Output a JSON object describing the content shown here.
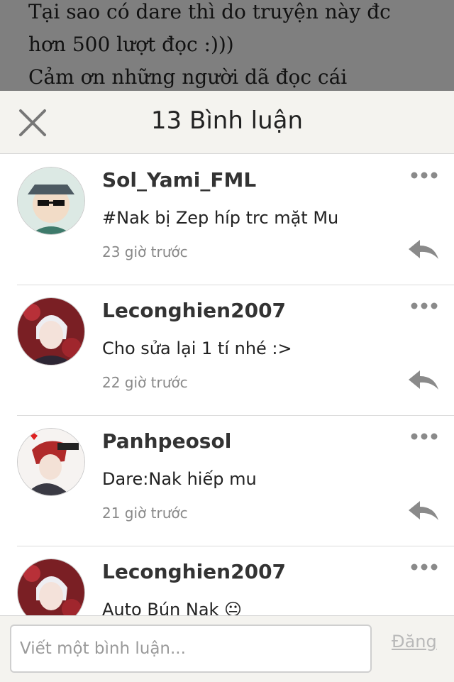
{
  "story": {
    "lines": [
      "Tại sao có dare thì do truyện này đc",
      "hơn 500 lượt đọc :)))",
      "Cảm ơn những người dã đọc cái"
    ]
  },
  "header": {
    "title": "13 Bình luận",
    "close_icon": "close-icon"
  },
  "comments": [
    {
      "username": "Sol_Yami_FML",
      "text": "#Nak bị Zep híp trc mặt Mu",
      "time": "23 giờ trước"
    },
    {
      "username": "Leconghien2007",
      "text": "Cho sửa lại 1 tí nhé :>",
      "time": "22 giờ trước"
    },
    {
      "username": "Panhpeosol",
      "text": "Dare:Nak hiếp mu",
      "time": "21 giờ trước"
    },
    {
      "username": "Leconghien2007",
      "text": "Auto Bún Nak 😐",
      "time": ""
    }
  ],
  "footer": {
    "input_placeholder": "Viết một bình luận...",
    "post_label": "Đăng"
  },
  "colors": {
    "header_bg": "#f4f3ef",
    "icon_gray": "#8a8a8a",
    "post_disabled": "#b9b9b9"
  }
}
